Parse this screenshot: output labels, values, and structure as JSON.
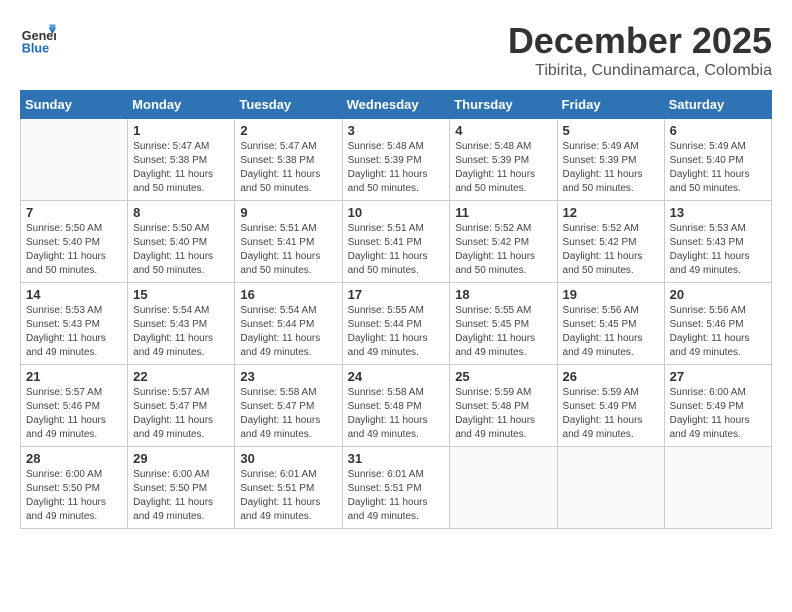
{
  "logo": {
    "general": "General",
    "blue": "Blue"
  },
  "header": {
    "month": "December 2025",
    "location": "Tibirita, Cundinamarca, Colombia"
  },
  "weekdays": [
    "Sunday",
    "Monday",
    "Tuesday",
    "Wednesday",
    "Thursday",
    "Friday",
    "Saturday"
  ],
  "weeks": [
    [
      {
        "day": "",
        "info": ""
      },
      {
        "day": "1",
        "info": "Sunrise: 5:47 AM\nSunset: 5:38 PM\nDaylight: 11 hours\nand 50 minutes."
      },
      {
        "day": "2",
        "info": "Sunrise: 5:47 AM\nSunset: 5:38 PM\nDaylight: 11 hours\nand 50 minutes."
      },
      {
        "day": "3",
        "info": "Sunrise: 5:48 AM\nSunset: 5:39 PM\nDaylight: 11 hours\nand 50 minutes."
      },
      {
        "day": "4",
        "info": "Sunrise: 5:48 AM\nSunset: 5:39 PM\nDaylight: 11 hours\nand 50 minutes."
      },
      {
        "day": "5",
        "info": "Sunrise: 5:49 AM\nSunset: 5:39 PM\nDaylight: 11 hours\nand 50 minutes."
      },
      {
        "day": "6",
        "info": "Sunrise: 5:49 AM\nSunset: 5:40 PM\nDaylight: 11 hours\nand 50 minutes."
      }
    ],
    [
      {
        "day": "7",
        "info": "Sunrise: 5:50 AM\nSunset: 5:40 PM\nDaylight: 11 hours\nand 50 minutes."
      },
      {
        "day": "8",
        "info": "Sunrise: 5:50 AM\nSunset: 5:40 PM\nDaylight: 11 hours\nand 50 minutes."
      },
      {
        "day": "9",
        "info": "Sunrise: 5:51 AM\nSunset: 5:41 PM\nDaylight: 11 hours\nand 50 minutes."
      },
      {
        "day": "10",
        "info": "Sunrise: 5:51 AM\nSunset: 5:41 PM\nDaylight: 11 hours\nand 50 minutes."
      },
      {
        "day": "11",
        "info": "Sunrise: 5:52 AM\nSunset: 5:42 PM\nDaylight: 11 hours\nand 50 minutes."
      },
      {
        "day": "12",
        "info": "Sunrise: 5:52 AM\nSunset: 5:42 PM\nDaylight: 11 hours\nand 50 minutes."
      },
      {
        "day": "13",
        "info": "Sunrise: 5:53 AM\nSunset: 5:43 PM\nDaylight: 11 hours\nand 49 minutes."
      }
    ],
    [
      {
        "day": "14",
        "info": "Sunrise: 5:53 AM\nSunset: 5:43 PM\nDaylight: 11 hours\nand 49 minutes."
      },
      {
        "day": "15",
        "info": "Sunrise: 5:54 AM\nSunset: 5:43 PM\nDaylight: 11 hours\nand 49 minutes."
      },
      {
        "day": "16",
        "info": "Sunrise: 5:54 AM\nSunset: 5:44 PM\nDaylight: 11 hours\nand 49 minutes."
      },
      {
        "day": "17",
        "info": "Sunrise: 5:55 AM\nSunset: 5:44 PM\nDaylight: 11 hours\nand 49 minutes."
      },
      {
        "day": "18",
        "info": "Sunrise: 5:55 AM\nSunset: 5:45 PM\nDaylight: 11 hours\nand 49 minutes."
      },
      {
        "day": "19",
        "info": "Sunrise: 5:56 AM\nSunset: 5:45 PM\nDaylight: 11 hours\nand 49 minutes."
      },
      {
        "day": "20",
        "info": "Sunrise: 5:56 AM\nSunset: 5:46 PM\nDaylight: 11 hours\nand 49 minutes."
      }
    ],
    [
      {
        "day": "21",
        "info": "Sunrise: 5:57 AM\nSunset: 5:46 PM\nDaylight: 11 hours\nand 49 minutes."
      },
      {
        "day": "22",
        "info": "Sunrise: 5:57 AM\nSunset: 5:47 PM\nDaylight: 11 hours\nand 49 minutes."
      },
      {
        "day": "23",
        "info": "Sunrise: 5:58 AM\nSunset: 5:47 PM\nDaylight: 11 hours\nand 49 minutes."
      },
      {
        "day": "24",
        "info": "Sunrise: 5:58 AM\nSunset: 5:48 PM\nDaylight: 11 hours\nand 49 minutes."
      },
      {
        "day": "25",
        "info": "Sunrise: 5:59 AM\nSunset: 5:48 PM\nDaylight: 11 hours\nand 49 minutes."
      },
      {
        "day": "26",
        "info": "Sunrise: 5:59 AM\nSunset: 5:49 PM\nDaylight: 11 hours\nand 49 minutes."
      },
      {
        "day": "27",
        "info": "Sunrise: 6:00 AM\nSunset: 5:49 PM\nDaylight: 11 hours\nand 49 minutes."
      }
    ],
    [
      {
        "day": "28",
        "info": "Sunrise: 6:00 AM\nSunset: 5:50 PM\nDaylight: 11 hours\nand 49 minutes."
      },
      {
        "day": "29",
        "info": "Sunrise: 6:00 AM\nSunset: 5:50 PM\nDaylight: 11 hours\nand 49 minutes."
      },
      {
        "day": "30",
        "info": "Sunrise: 6:01 AM\nSunset: 5:51 PM\nDaylight: 11 hours\nand 49 minutes."
      },
      {
        "day": "31",
        "info": "Sunrise: 6:01 AM\nSunset: 5:51 PM\nDaylight: 11 hours\nand 49 minutes."
      },
      {
        "day": "",
        "info": ""
      },
      {
        "day": "",
        "info": ""
      },
      {
        "day": "",
        "info": ""
      }
    ]
  ]
}
